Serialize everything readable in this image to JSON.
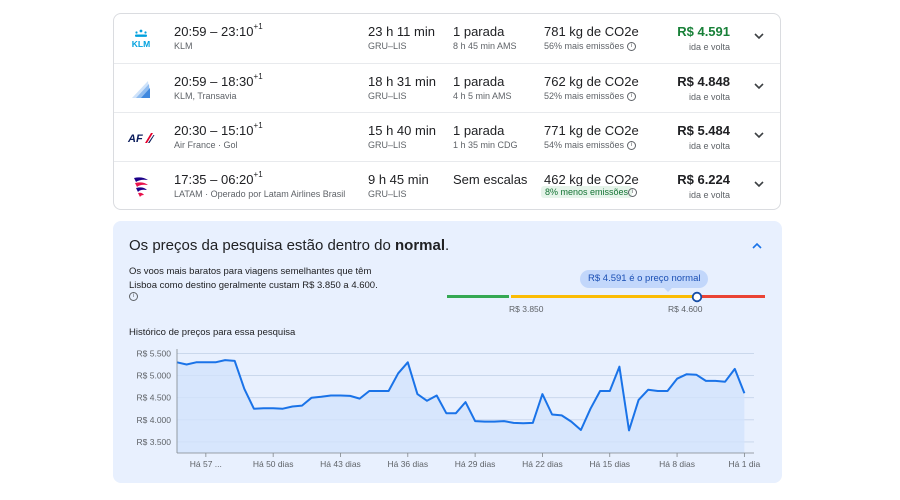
{
  "flights": [
    {
      "airline_logo": "klm-logo",
      "times": "20:59 – 23:10",
      "day_offset": "+1",
      "airline": "KLM",
      "duration": "23 h 11 min",
      "route": "GRU–LIS",
      "stops": "1 parada",
      "layover": "8 h 45 min AMS",
      "co2": "781 kg de CO2e",
      "co2_note": "56% mais emissões",
      "co2_note_good": false,
      "price": "R$ 4.591",
      "price_highlight": true,
      "price_note": "ida e volta"
    },
    {
      "airline_logo": "transavia-logo",
      "times": "20:59 – 18:30",
      "day_offset": "+1",
      "airline": "KLM, Transavia",
      "duration": "18 h 31 min",
      "route": "GRU–LIS",
      "stops": "1 parada",
      "layover": "4 h 5 min AMS",
      "co2": "762 kg de CO2e",
      "co2_note": "52% mais emissões",
      "co2_note_good": false,
      "price": "R$ 4.848",
      "price_highlight": false,
      "price_note": "ida e volta"
    },
    {
      "airline_logo": "air-france-logo",
      "times": "20:30 – 15:10",
      "day_offset": "+1",
      "airline": "Air France · Gol",
      "duration": "15 h 40 min",
      "route": "GRU–LIS",
      "stops": "1 parada",
      "layover": "1 h 35 min CDG",
      "co2": "771 kg de CO2e",
      "co2_note": "54% mais emissões",
      "co2_note_good": false,
      "price": "R$ 5.484",
      "price_highlight": false,
      "price_note": "ida e volta"
    },
    {
      "airline_logo": "latam-logo",
      "times": "17:35 – 06:20",
      "day_offset": "+1",
      "airline": "LATAM · Operado por Latam Airlines Brasil",
      "duration": "9 h 45 min",
      "route": "GRU–LIS",
      "stops": "Sem escalas",
      "layover": "",
      "co2": "462 kg de CO2e",
      "co2_note": "8% menos emissões",
      "co2_note_good": true,
      "price": "R$ 6.224",
      "price_highlight": false,
      "price_note": "ida e volta"
    }
  ],
  "logos": {
    "klm": "KLM",
    "air_france": "AF"
  },
  "insight": {
    "title_prefix": "Os preços da pesquisa estão dentro do ",
    "title_bold": "normal",
    "title_suffix": ".",
    "description": "Os voos mais baratos para viagens semelhantes que têm Lisboa como destino geralmente custam R$ 3.850 a 4.600.",
    "tooltip": "R$ 4.591 é o preço normal",
    "range_low_label": "R$ 3.850",
    "range_high_label": "R$ 4.600",
    "range_low": 3850,
    "range_high": 4600,
    "current_price": 4591,
    "history_label": "Histórico de preços para essa pesquisa",
    "colors": {
      "low": "#34a853",
      "typical": "#fbbc04",
      "high": "#ea4335",
      "line": "#1a73e8",
      "fill": "#d2e3fc"
    }
  },
  "chart_data": {
    "type": "area",
    "y_ticks": [
      "R$ 5.500",
      "R$ 5.000",
      "R$ 4.500",
      "R$ 4.000",
      "R$ 3.500"
    ],
    "ylim": [
      3250,
      5600
    ],
    "x_ticks": [
      "Há 57 ...",
      "Há 50 dias",
      "Há 43 dias",
      "Há 36 dias",
      "Há 29 dias",
      "Há 22 dias",
      "Há 15 dias",
      "Há 8 dias",
      "Há 1 dia"
    ],
    "x_tick_days": [
      57,
      50,
      43,
      36,
      29,
      22,
      15,
      8,
      1
    ],
    "x": [
      60,
      59,
      58,
      57,
      56,
      55,
      54,
      53,
      52,
      51,
      50,
      49,
      48,
      47,
      46,
      45,
      44,
      43,
      42,
      41,
      40,
      39,
      38,
      37,
      36,
      35,
      34,
      33,
      32,
      31,
      30,
      29,
      28,
      27,
      26,
      25,
      24,
      23,
      22,
      21,
      20,
      19,
      18,
      17,
      16,
      15,
      14,
      13,
      12,
      11,
      10,
      9,
      8,
      7,
      6,
      5,
      4,
      3,
      2,
      1,
      0
    ],
    "values": [
      5300,
      5250,
      5300,
      5300,
      5300,
      5350,
      5330,
      4700,
      4250,
      4260,
      4260,
      4250,
      4300,
      4320,
      4500,
      4520,
      4550,
      4550,
      4540,
      4480,
      4650,
      4650,
      4650,
      5050,
      5300,
      4580,
      4430,
      4550,
      4150,
      4150,
      4400,
      3970,
      3960,
      3960,
      3970,
      3930,
      3920,
      3930,
      4580,
      4120,
      4100,
      3960,
      3770,
      4250,
      4650,
      4650,
      5200,
      3760,
      4450,
      4680,
      4650,
      4650,
      4930,
      5030,
      5020,
      4880,
      4880,
      4860,
      5150,
      4600,
      null
    ]
  }
}
